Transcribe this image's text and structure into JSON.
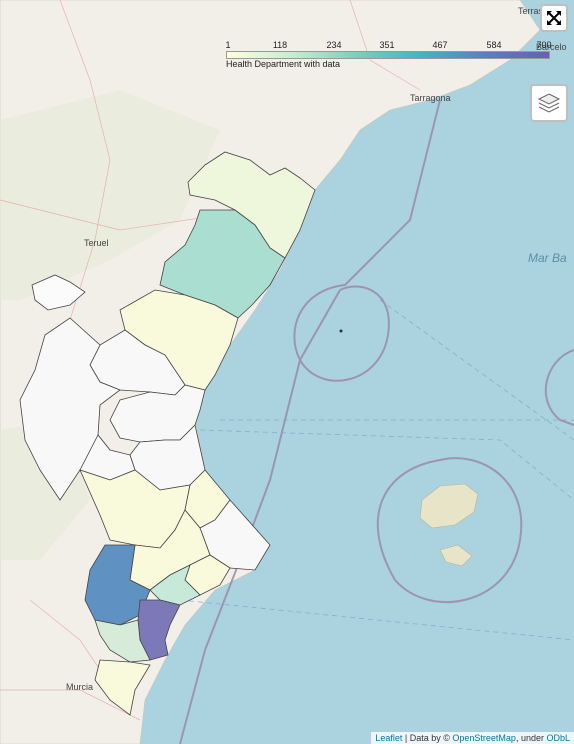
{
  "legend": {
    "ticks": [
      "1",
      "118",
      "234",
      "351",
      "467",
      "584",
      "700"
    ],
    "title": "Health Department with data",
    "colors": [
      "#ffffe0",
      "#c8ecd0",
      "#7fcdbb",
      "#41b6c4",
      "#5b7fbf",
      "#6a5fb0"
    ]
  },
  "controls": {
    "fullscreen_icon": "fullscreen-icon",
    "layers_icon": "layers-icon"
  },
  "place_labels": {
    "tarragona": "Tarragona",
    "teruel": "Teruel",
    "murcia": "Murcia",
    "sea": "Mar Ba",
    "barcelona": "Barcelo",
    "terrassa": "Terras"
  },
  "attribution": {
    "leaflet": "Leaflet",
    "sep": "|",
    "data_by": "Data by ©",
    "osm": "OpenStreetMap",
    "under": ", under",
    "odbl": "ODbL"
  },
  "colors": {
    "sea": "#aad3df",
    "land": "#f2efe9",
    "choropleth_low": "#ffffe0",
    "choropleth_mid": "#7fcdbb",
    "choropleth_high": "#6a5fb0",
    "no_data": "#f7f7f7"
  }
}
